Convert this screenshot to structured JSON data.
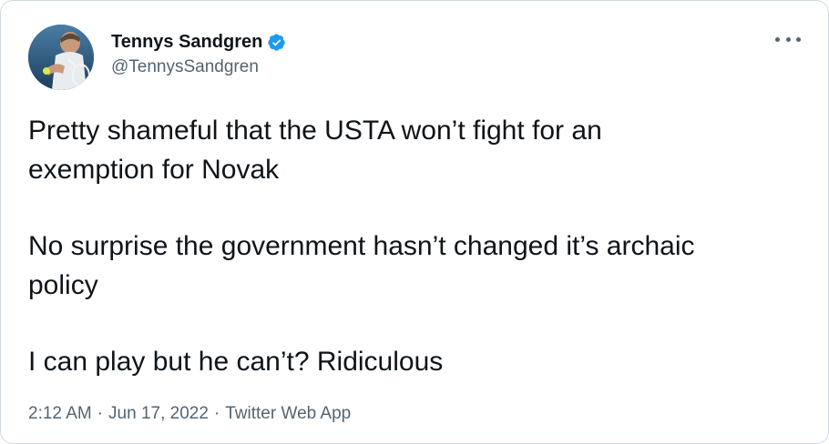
{
  "author": {
    "name": "Tennys Sandgren",
    "handle": "@TennysSandgren",
    "verified": true,
    "avatar_icon": "tennis-player-avatar"
  },
  "tweet": {
    "paragraphs": [
      [
        "Pretty shameful that the USTA won’t fight for an",
        "exemption for Novak"
      ],
      [
        "No surprise the government hasn’t changed it’s archaic",
        "policy"
      ],
      [
        "I can play but he can’t? Ridiculous"
      ]
    ],
    "time": "2:12 AM",
    "date": "Jun 17, 2022",
    "source": "Twitter Web App",
    "separator": "·"
  },
  "icons": {
    "more": "more-options-icon",
    "verified": "verified-badge-icon"
  },
  "colors": {
    "text": "#0f1419",
    "secondary": "#536471",
    "verified_blue": "#1d9bf0",
    "border": "#cfd9de"
  }
}
